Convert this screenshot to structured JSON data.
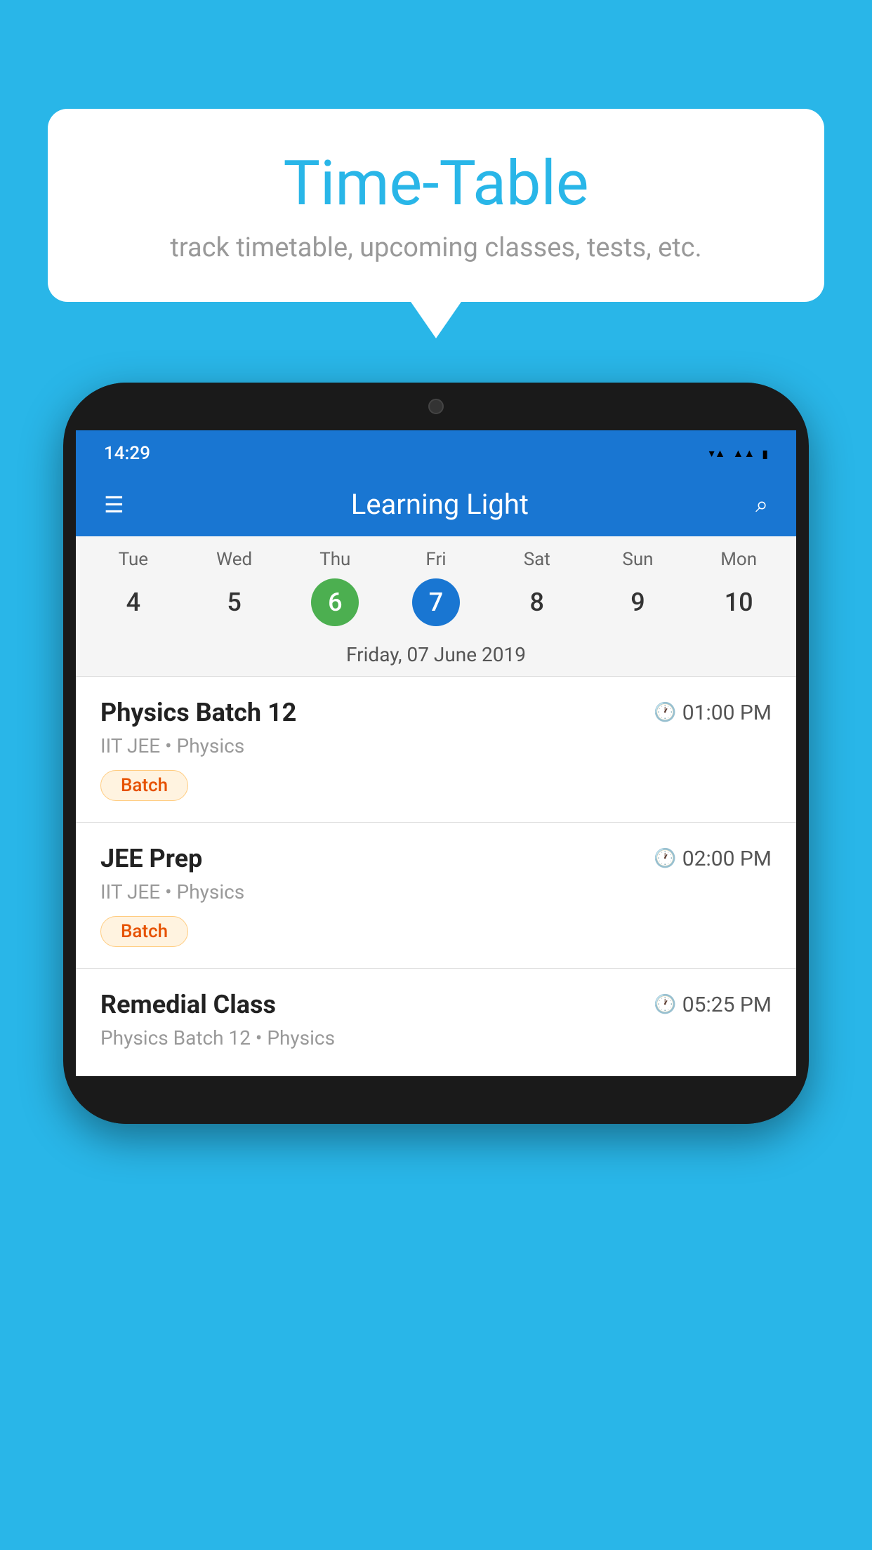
{
  "background_color": "#29b6e8",
  "speech_bubble": {
    "title": "Time-Table",
    "subtitle": "track timetable, upcoming classes, tests, etc."
  },
  "phone": {
    "status_bar": {
      "time": "14:29",
      "wifi_icon": "wifi",
      "signal_icon": "signal",
      "battery_icon": "battery"
    },
    "app_bar": {
      "title": "Learning Light",
      "menu_icon": "☰",
      "search_icon": "🔍"
    },
    "calendar": {
      "days": [
        {
          "label": "Tue",
          "number": "4"
        },
        {
          "label": "Wed",
          "number": "5"
        },
        {
          "label": "Thu",
          "number": "6",
          "state": "today"
        },
        {
          "label": "Fri",
          "number": "7",
          "state": "selected"
        },
        {
          "label": "Sat",
          "number": "8"
        },
        {
          "label": "Sun",
          "number": "9"
        },
        {
          "label": "Mon",
          "number": "10"
        }
      ],
      "current_date": "Friday, 07 June 2019"
    },
    "schedule": [
      {
        "title": "Physics Batch 12",
        "time": "01:00 PM",
        "subtitle": "IIT JEE • Physics",
        "badge": "Batch"
      },
      {
        "title": "JEE Prep",
        "time": "02:00 PM",
        "subtitle": "IIT JEE • Physics",
        "badge": "Batch"
      },
      {
        "title": "Remedial Class",
        "time": "05:25 PM",
        "subtitle": "Physics Batch 12 • Physics",
        "badge": null
      }
    ]
  }
}
